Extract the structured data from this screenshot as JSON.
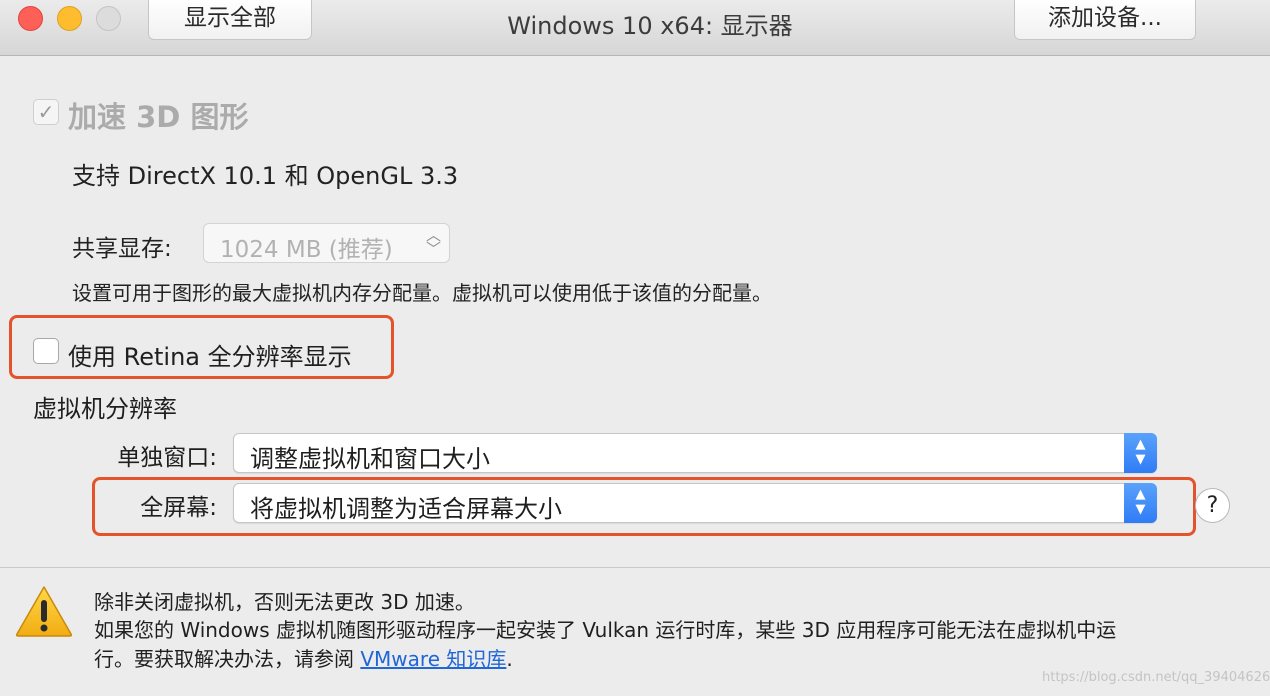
{
  "window": {
    "title": "Windows 10 x64: 显示器",
    "show_all_label": "显示全部",
    "add_device_label": "添加设备..."
  },
  "accel3d": {
    "label": "加速 3D 图形",
    "checked": true,
    "enabled": false,
    "check_glyph": "✓",
    "support_text": "支持 DirectX 10.1 和 OpenGL 3.3"
  },
  "shared_memory": {
    "label": "共享显存:",
    "value": "1024 MB (推荐)",
    "hint": "设置可用于图形的最大虚拟机内存分配量。虚拟机可以使用低于该值的分配量。"
  },
  "retina": {
    "label": "使用 Retina 全分辨率显示",
    "checked": false
  },
  "resolution": {
    "heading": "虚拟机分辨率",
    "single_window_label": "单独窗口:",
    "single_window_value": "调整虚拟机和窗口大小",
    "full_screen_label": "全屏幕:",
    "full_screen_value": "将虚拟机调整为适合屏幕大小",
    "help_label": "?"
  },
  "notice": {
    "line1": "除非关闭虚拟机，否则无法更改 3D 加速。",
    "line2": "如果您的 Windows 虚拟机随图形驱动程序一起安装了 Vulkan 运行时库，某些 3D 应用程序可能无法在虚拟机中运",
    "line3_prefix": "行。要获取解决办法，请参阅 ",
    "link_text": "VMware 知识库",
    "line3_suffix": "."
  },
  "watermark": "https://blog.csdn.net/qq_39404626",
  "icons": {
    "stepper": "up-down-chevron-icon",
    "warning": "warning-triangle-icon"
  },
  "colors": {
    "highlight": "#e5532d",
    "accent": "#2f7cf6",
    "link": "#1f66d6"
  }
}
